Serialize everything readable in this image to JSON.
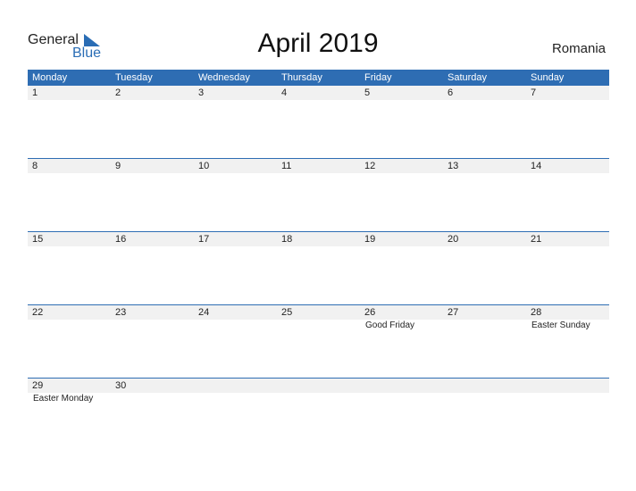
{
  "logo": {
    "general": "General",
    "blue": "Blue"
  },
  "title": "April 2019",
  "country": "Romania",
  "colors": {
    "accent": "#2e6db3",
    "row_bg": "#f1f1f1"
  },
  "days": [
    "Monday",
    "Tuesday",
    "Wednesday",
    "Thursday",
    "Friday",
    "Saturday",
    "Sunday"
  ],
  "weeks": [
    {
      "nums": [
        "1",
        "2",
        "3",
        "4",
        "5",
        "6",
        "7"
      ],
      "events": [
        "",
        "",
        "",
        "",
        "",
        "",
        ""
      ]
    },
    {
      "nums": [
        "8",
        "9",
        "10",
        "11",
        "12",
        "13",
        "14"
      ],
      "events": [
        "",
        "",
        "",
        "",
        "",
        "",
        ""
      ]
    },
    {
      "nums": [
        "15",
        "16",
        "17",
        "18",
        "19",
        "20",
        "21"
      ],
      "events": [
        "",
        "",
        "",
        "",
        "",
        "",
        ""
      ]
    },
    {
      "nums": [
        "22",
        "23",
        "24",
        "25",
        "26",
        "27",
        "28"
      ],
      "events": [
        "",
        "",
        "",
        "",
        "Good Friday",
        "",
        "Easter Sunday"
      ]
    },
    {
      "nums": [
        "29",
        "30",
        "",
        "",
        "",
        "",
        ""
      ],
      "events": [
        "Easter Monday",
        "",
        "",
        "",
        "",
        "",
        ""
      ]
    }
  ]
}
